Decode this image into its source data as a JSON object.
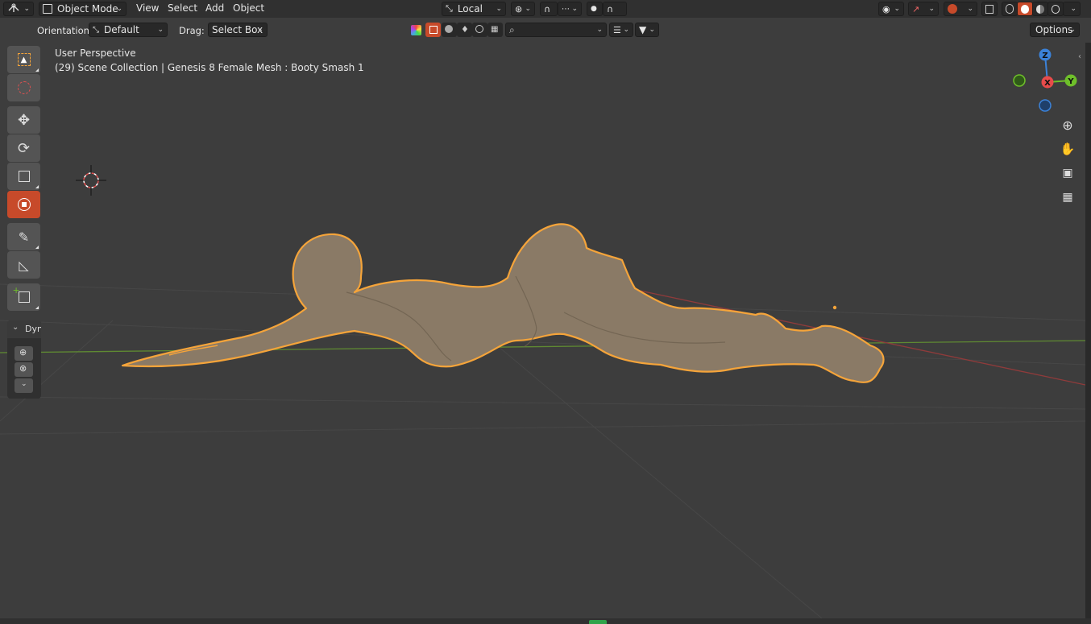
{
  "header": {
    "editor_type_icon": "view3d-icon",
    "mode": "Object Mode",
    "menus": [
      "View",
      "Select",
      "Add",
      "Object"
    ],
    "transform_orientation": "Local"
  },
  "toolsettings": {
    "orientation_label": "Orientation:",
    "orientation_value": "Default",
    "drag_label": "Drag:",
    "drag_value": "Select Box",
    "options_label": "Options"
  },
  "viewport": {
    "view_name": "User Perspective",
    "scene_info": "(29) Scene Collection | Genesis 8 Female Mesh : Booty Smash 1"
  },
  "toolbar": {
    "tools": [
      "select-box",
      "cursor",
      "move",
      "rotate",
      "scale",
      "transform",
      "annotate",
      "measure",
      "add-cube"
    ],
    "active_tool": "transform"
  },
  "side_panel": {
    "title": "Dyn"
  },
  "gizmo": {
    "z_label": "Z",
    "x_label": "X",
    "y_label": "Y"
  },
  "colors": {
    "accent": "#c74a2a",
    "selection_outline": "#f5a43a",
    "x_axis": "#e84b4b",
    "y_axis": "#6ebf2a",
    "z_axis": "#3b82d9",
    "background": "#3d3d3d"
  }
}
